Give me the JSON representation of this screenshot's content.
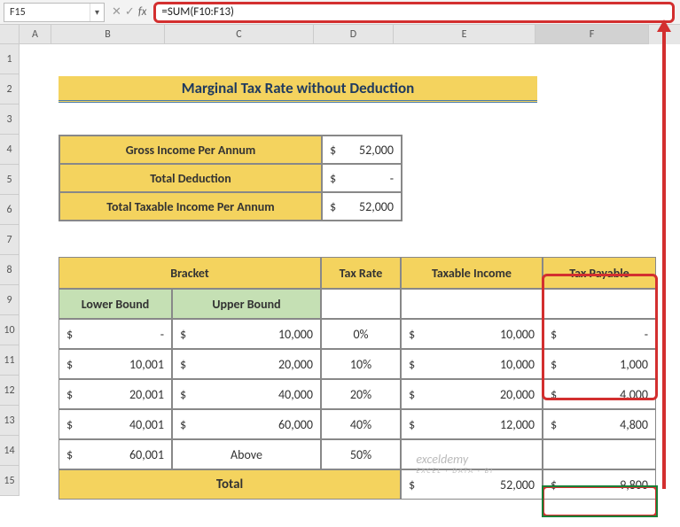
{
  "name_box": "F15",
  "formula": "=SUM(F10:F13)",
  "columns": [
    "A",
    "B",
    "C",
    "D",
    "E",
    "F"
  ],
  "rows": [
    "1",
    "2",
    "3",
    "4",
    "5",
    "6",
    "7",
    "8",
    "9",
    "10",
    "11",
    "12",
    "13",
    "14",
    "15"
  ],
  "title": "Marginal Tax Rate without Deduction",
  "summary": {
    "gross_label": "Gross Income Per Annum",
    "gross_value": "52,000",
    "deduct_label": "Total Deduction",
    "deduct_value": "-",
    "taxable_label": "Total Taxable Income Per Annum",
    "taxable_value": "52,000"
  },
  "headers": {
    "bracket": "Bracket",
    "lower": "Lower Bound",
    "upper": "Upper Bound",
    "rate": "Tax Rate",
    "taxable": "Taxable Income",
    "payable": "Tax Payable",
    "total": "Total"
  },
  "brackets": [
    {
      "lb": "-",
      "ub": "10,000",
      "rate": "0%",
      "ti": "10,000",
      "tp": "-"
    },
    {
      "lb": "10,001",
      "ub": "20,000",
      "rate": "10%",
      "ti": "10,000",
      "tp": "1,000"
    },
    {
      "lb": "20,001",
      "ub": "40,000",
      "rate": "20%",
      "ti": "20,000",
      "tp": "4,000"
    },
    {
      "lb": "40,001",
      "ub": "60,000",
      "rate": "40%",
      "ti": "12,000",
      "tp": "4,800"
    },
    {
      "lb": "60,001",
      "ub": "Above",
      "rate": "50%",
      "ti": "",
      "tp": ""
    }
  ],
  "totals": {
    "ti": "52,000",
    "tp": "9,800"
  },
  "dollar": "$",
  "watermark": "exceldemy",
  "watermark_sub": "EXCEL · DATA · BI",
  "chart_data": {
    "type": "table",
    "title": "Marginal Tax Rate without Deduction",
    "gross_income": 52000,
    "total_deduction": 0,
    "taxable_income": 52000,
    "brackets": [
      {
        "lower": 0,
        "upper": 10000,
        "rate": 0.0,
        "taxable": 10000,
        "payable": 0
      },
      {
        "lower": 10001,
        "upper": 20000,
        "rate": 0.1,
        "taxable": 10000,
        "payable": 1000
      },
      {
        "lower": 20001,
        "upper": 40000,
        "rate": 0.2,
        "taxable": 20000,
        "payable": 4000
      },
      {
        "lower": 40001,
        "upper": 60000,
        "rate": 0.4,
        "taxable": 12000,
        "payable": 4800
      },
      {
        "lower": 60001,
        "upper": null,
        "rate": 0.5,
        "taxable": null,
        "payable": null
      }
    ],
    "total_taxable": 52000,
    "total_payable": 9800
  }
}
